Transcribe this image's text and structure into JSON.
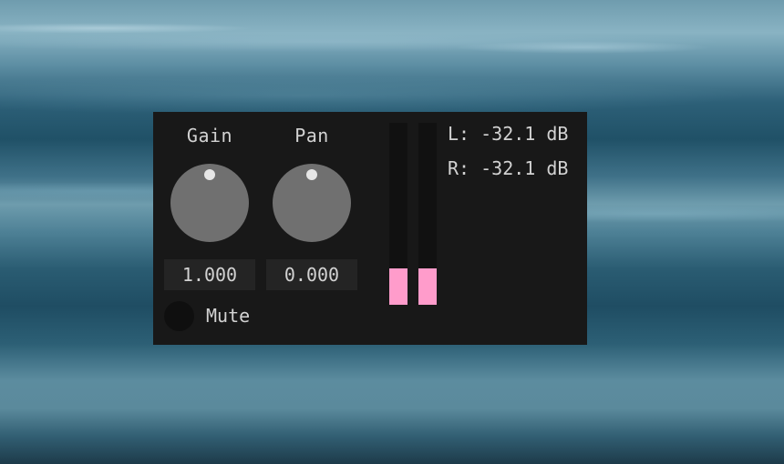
{
  "mixer": {
    "gain": {
      "label": "Gain",
      "value": "1.000"
    },
    "pan": {
      "label": "Pan",
      "value": "0.000"
    },
    "mute": {
      "label": "Mute",
      "on": false
    },
    "meters": {
      "left": {
        "readout": "L: -32.1 dB",
        "level": 0.2
      },
      "right": {
        "readout": "R: -32.1 dB",
        "level": 0.2
      }
    },
    "colors": {
      "panel": "#181818",
      "knob": "#707070",
      "meter_fill": "#ff9ccb",
      "text": "#d2d2d2"
    }
  }
}
